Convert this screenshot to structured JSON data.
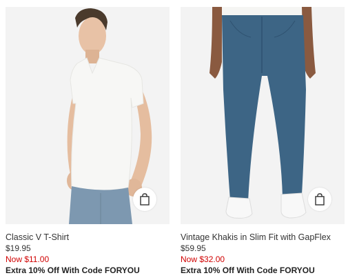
{
  "products": [
    {
      "name": "Classic V T-Shirt",
      "price": "$19.95",
      "sale_price": "Now $11.00",
      "promo": "Extra 10% Off With Code FORYOU",
      "icon": "shopping-bag-icon"
    },
    {
      "name": "Vintage Khakis in Slim Fit with GapFlex",
      "price": "$59.95",
      "sale_price": "Now $32.00",
      "promo": "Extra 10% Off With Code FORYOU",
      "icon": "shopping-bag-icon"
    }
  ],
  "colors": {
    "sale": "#d00000",
    "image_bg": "#f3f3f3",
    "tshirt": "#f7f7f5",
    "denim": "#7d98b0",
    "khaki_blue": "#3d6585"
  }
}
